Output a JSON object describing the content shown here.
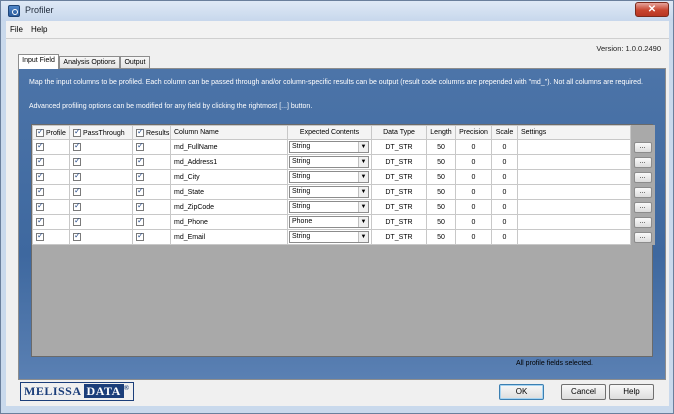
{
  "window": {
    "title": "Profiler",
    "close_label": "✕"
  },
  "menu": [
    {
      "label": "File"
    },
    {
      "label": "Help"
    }
  ],
  "version": "Version: 1.0.0.2490",
  "tabs": [
    {
      "label": "Input Field"
    },
    {
      "label": "Analysis Options"
    },
    {
      "label": "Output"
    }
  ],
  "description": {
    "line1": "Map the input columns to be profiled. Each column can be passed through and/or column-specific results can be output (result code columns are prepended with \"md_\"). Not all columns are required.",
    "line2": "Advanced profiling options can be modified for any field by clicking the rightmost [...] button."
  },
  "grid": {
    "headers": {
      "profile": "Profile",
      "passthrough": "PassThrough",
      "results": "Results",
      "column_name": "Column Name",
      "expected": "Expected Contents",
      "data_type": "Data Type",
      "length": "Length",
      "precision": "Precision",
      "scale": "Scale",
      "settings": "Settings"
    },
    "rows": [
      {
        "column_name": "md_FullName",
        "expected": "String",
        "data_type": "DT_STR",
        "length": "50",
        "precision": "0",
        "scale": "0",
        "button": "..."
      },
      {
        "column_name": "md_Address1",
        "expected": "String",
        "data_type": "DT_STR",
        "length": "50",
        "precision": "0",
        "scale": "0",
        "button": "..."
      },
      {
        "column_name": "md_City",
        "expected": "String",
        "data_type": "DT_STR",
        "length": "50",
        "precision": "0",
        "scale": "0",
        "button": "..."
      },
      {
        "column_name": "md_State",
        "expected": "String",
        "data_type": "DT_STR",
        "length": "50",
        "precision": "0",
        "scale": "0",
        "button": "..."
      },
      {
        "column_name": "md_ZipCode",
        "expected": "String",
        "data_type": "DT_STR",
        "length": "50",
        "precision": "0",
        "scale": "0",
        "button": "..."
      },
      {
        "column_name": "md_Phone",
        "expected": "Phone",
        "data_type": "DT_STR",
        "length": "50",
        "precision": "0",
        "scale": "0",
        "button": "..."
      },
      {
        "column_name": "md_Email",
        "expected": "String",
        "data_type": "DT_STR",
        "length": "50",
        "precision": "0",
        "scale": "0",
        "button": "..."
      }
    ]
  },
  "status": "All profile fields selected.",
  "logo": {
    "part1": "MELISSA",
    "part2": "DATA",
    "mark": "®"
  },
  "buttons": {
    "ok": "OK",
    "cancel": "Cancel",
    "help": "Help"
  }
}
